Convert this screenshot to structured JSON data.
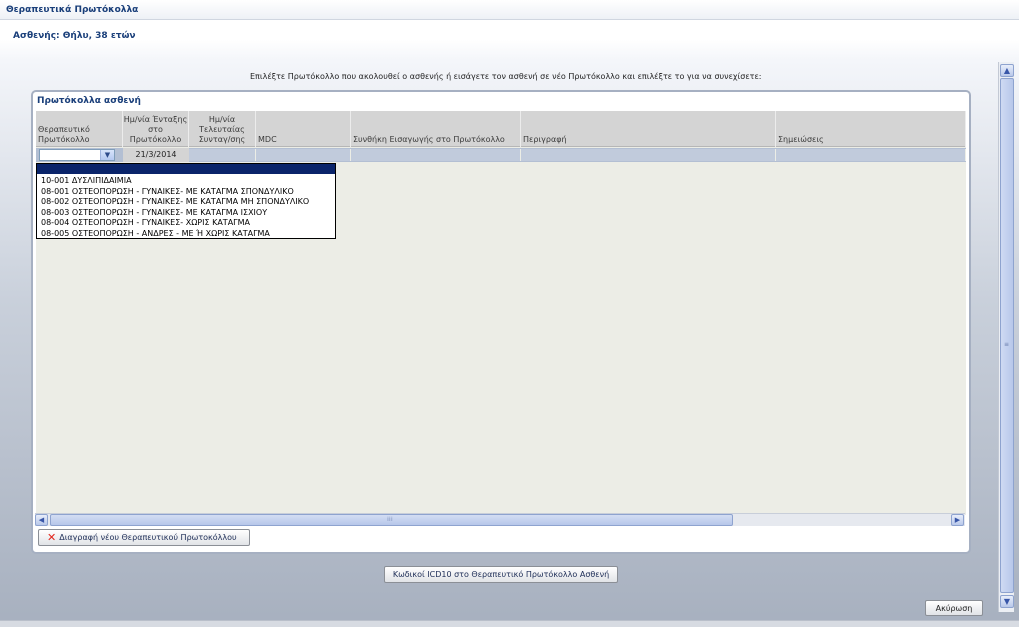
{
  "window": {
    "title": "Θεραπευτικά Πρωτόκολλα"
  },
  "patient": {
    "info": "Ασθενής: Θήλυ, 38 ετών"
  },
  "instructions": "Επιλέξτε Πρωτόκολλο που ακολουθεί ο ασθενής ή εισάγετε τον ασθενή σε νέο Πρωτόκολλο και επιλέξτε το για να συνεχίσετε:",
  "panel": {
    "title": "Πρωτόκολλα ασθενή"
  },
  "table": {
    "headers": {
      "protocol": "Θεραπευτικό Πρωτόκολλο",
      "entry_date": "Ημ/νία Ένταξης στο Πρωτόκολλο",
      "last_prescription": "Ημ/νία Τελευταίας Συνταγ/σης",
      "mdc": "MDC",
      "entry_condition": "Συνθήκη Εισαγωγής στο Πρωτόκολλο",
      "description": "Περιγραφή",
      "notes": "Σημειώσεις"
    },
    "row": {
      "protocol": "",
      "entry_date": "21/3/2014",
      "last_prescription": "",
      "mdc": "",
      "entry_condition": "",
      "description": "",
      "notes": ""
    }
  },
  "dropdown": {
    "options": [
      "10-001 ΔΥΣΛΙΠΙΔΑΙΜΙΑ",
      "08-001 ΟΣΤΕΟΠΟΡΩΣΗ - ΓΥΝΑΙΚΕΣ- ΜΕ ΚΑΤΑΓΜΑ ΣΠΟΝΔΥΛΙΚΟ",
      "08-002 ΟΣΤΕΟΠΟΡΩΣΗ - ΓΥΝΑΙΚΕΣ- ΜΕ ΚΑΤΑΓΜΑ ΜΗ ΣΠΟΝΔΥΛΙΚΟ",
      "08-003 ΟΣΤΕΟΠΟΡΩΣΗ - ΓΥΝΑΙΚΕΣ- ΜΕ ΚΑΤΑΓΜΑ ΙΣΧΙΟΥ",
      "08-004 ΟΣΤΕΟΠΟΡΩΣΗ - ΓΥΝΑΙΚΕΣ- ΧΩΡΙΣ ΚΑΤΑΓΜΑ",
      "08-005 ΟΣΤΕΟΠΟΡΩΣΗ - ΑΝΔΡΕΣ - ΜΕ Ή ΧΩΡΙΣ ΚΑΤΑΓΜΑ"
    ]
  },
  "buttons": {
    "delete_new": "Διαγραφή νέου Θεραπευτικού Πρωτοκόλλου",
    "icd10": "Κωδικοί ICD10 στο Θεραπευτικό Πρωτόκολλο Ασθενή",
    "cancel": "Ακύρωση"
  },
  "icons": {
    "delete": "close-x-icon",
    "dropdown": "chevron-down-icon"
  },
  "colors": {
    "title": "#1a3f7a",
    "selection": "#0a246a",
    "row_highlight": "#b3bfd3",
    "delete_x": "#e2261c"
  }
}
